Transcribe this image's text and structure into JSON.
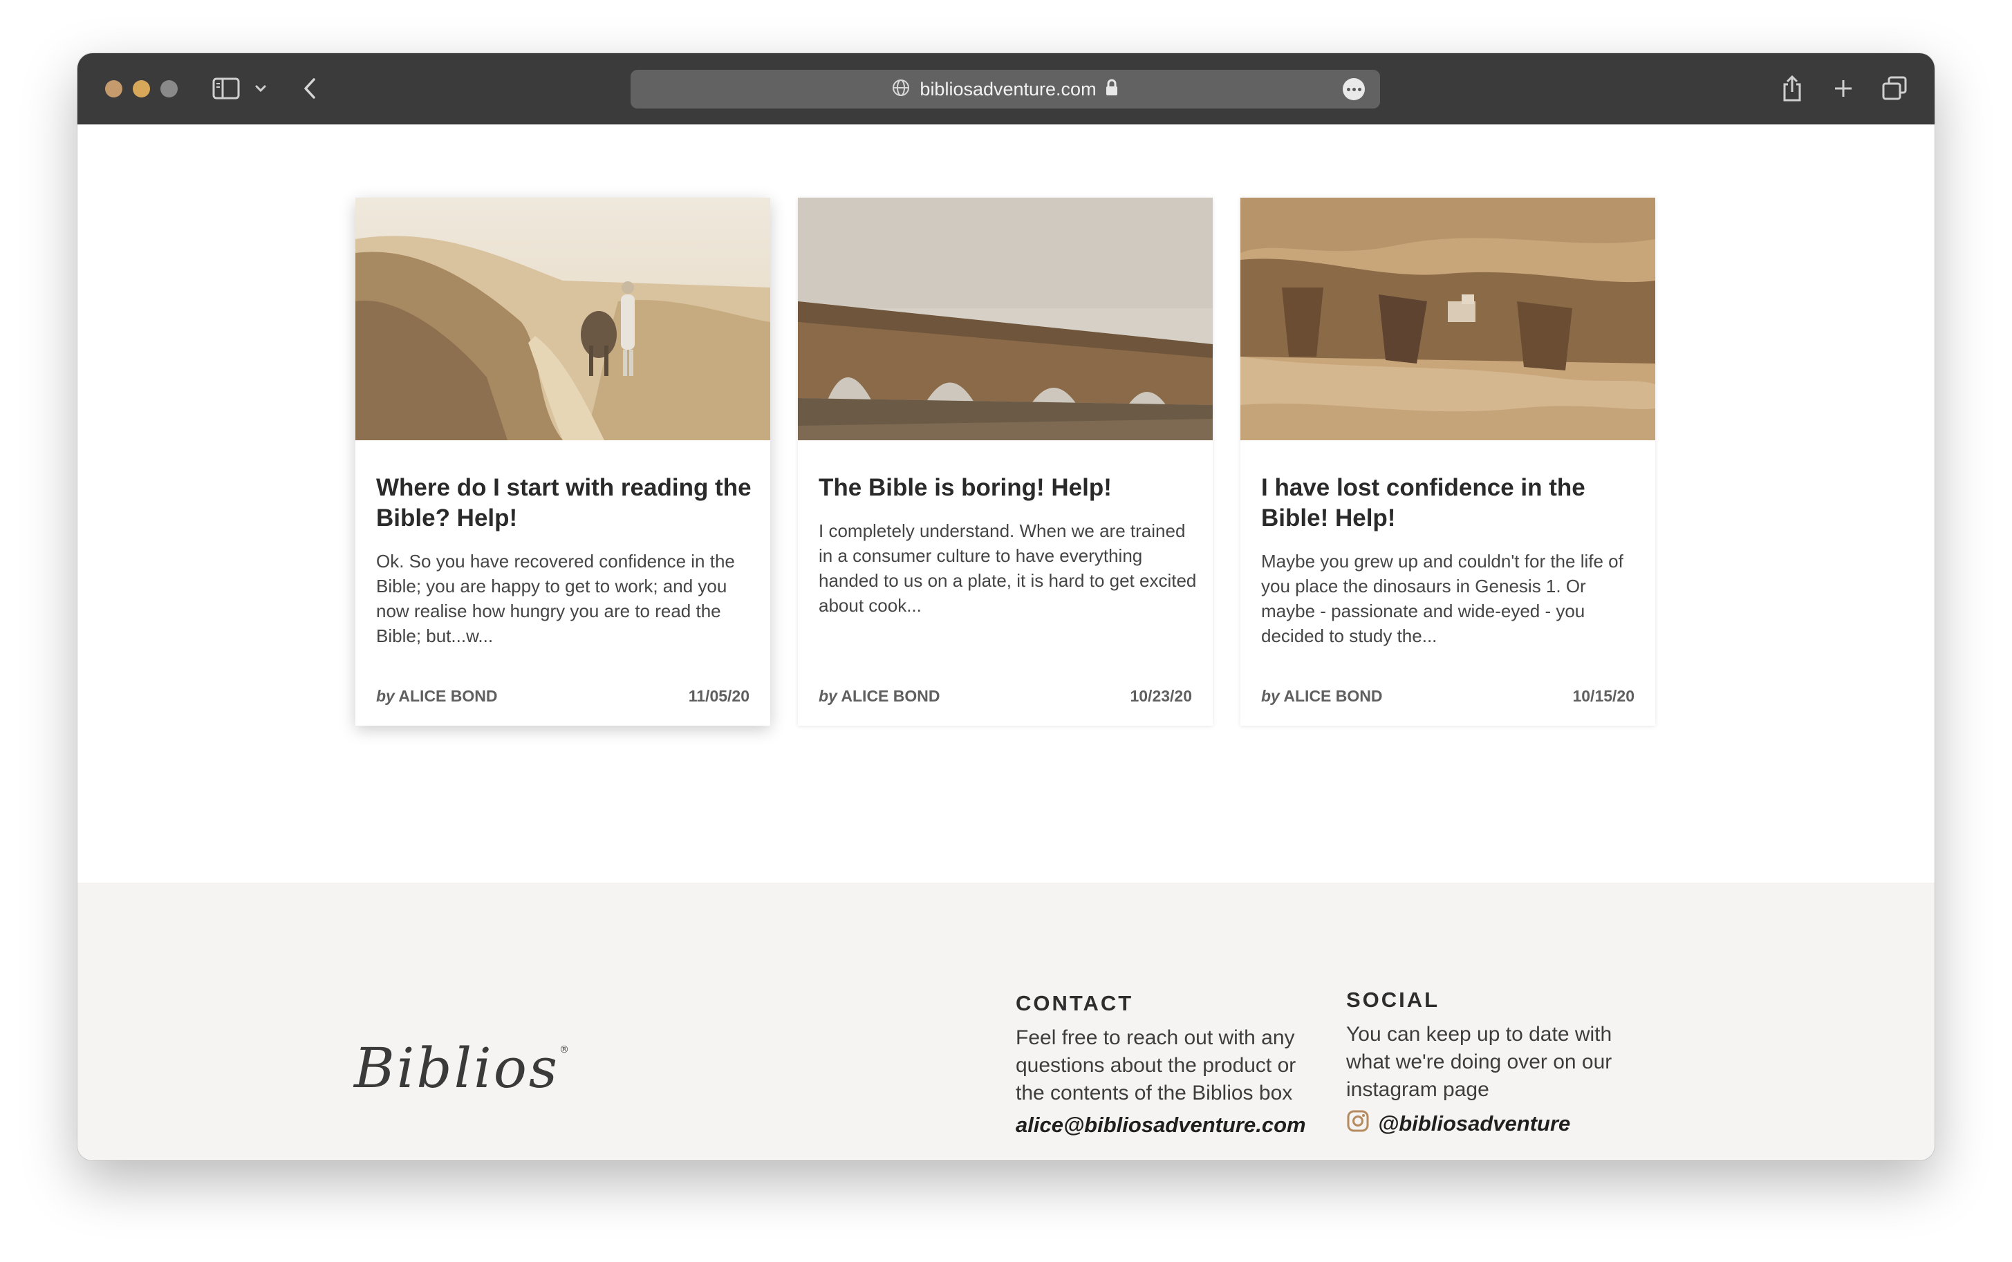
{
  "browser": {
    "url": "bibliosadventure.com",
    "traffic_colors": [
      "#c59a6d",
      "#d8a85a",
      "#8a8a8a"
    ]
  },
  "posts": [
    {
      "title": "Where do I start with reading the Bible? Help!",
      "excerpt": "Ok. So you have recovered confidence in the Bible; you are happy to get to work; and you now realise how hungry you are to read the Bible;  but...w...",
      "by_label": "by",
      "author": "ALICE BOND",
      "date": "11/05/20",
      "image": "desert-donkey-photo"
    },
    {
      "title": "The Bible is boring! Help!",
      "excerpt": "I completely understand. When we are trained in a consumer culture to have everything handed to us on a plate, it is hard to get excited about cook...",
      "by_label": "by",
      "author": "ALICE BOND",
      "date": "10/23/20",
      "image": "aqueduct-photo"
    },
    {
      "title": "I have lost confidence in the Bible! Help!",
      "excerpt": "Maybe you grew up and couldn't for the life of you place the dinosaurs in Genesis 1. Or maybe - passionate and wide-eyed - you decided to study the...",
      "by_label": "by",
      "author": "ALICE BOND",
      "date": "10/15/20",
      "image": "canyon-monastery-photo"
    }
  ],
  "footer": {
    "logo": "Biblios",
    "logo_mark": "®",
    "contact": {
      "heading": "CONTACT",
      "text": "Feel free to reach out with any questions about the product or the contents of the Biblios box",
      "email": "alice@bibliosadventure.com"
    },
    "social": {
      "heading": "SOCIAL",
      "text": "You can keep up to date with what we're doing over on our instagram page",
      "handle": "@bibliosadventure",
      "icon": "instagram-icon"
    }
  }
}
